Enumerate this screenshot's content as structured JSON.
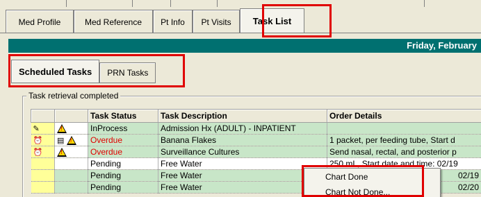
{
  "main_tabs": [
    {
      "label": "Med Profile",
      "active": false
    },
    {
      "label": "Med Reference",
      "active": false
    },
    {
      "label": "Pt Info",
      "active": false
    },
    {
      "label": "Pt Visits",
      "active": false
    },
    {
      "label": "Task List",
      "active": true
    }
  ],
  "date_header": "Friday, February",
  "sub_tabs": [
    {
      "label": "Scheduled Tasks",
      "active": true
    },
    {
      "label": "PRN Tasks",
      "active": false
    }
  ],
  "group_label": "Task retrieval completed",
  "table": {
    "headers": [
      "",
      "",
      "Task Status",
      "Task Description",
      "Order Details"
    ],
    "rows": [
      {
        "status": "InProcess",
        "description": "Admission Hx (ADULT) - INPATIENT",
        "details": "",
        "style": "green",
        "icons": [
          "pencil-icon",
          "warning-icon"
        ]
      },
      {
        "status": "Overdue",
        "description": "Banana Flakes",
        "details": "1 packet, per feeding tube, Start d",
        "style": "green",
        "icons": [
          "clock-icon",
          "note-icon",
          "warning-icon"
        ]
      },
      {
        "status": "Overdue",
        "description": "Surveillance Cultures",
        "details": "Send nasal, rectal, and posterior p",
        "style": "green",
        "icons": [
          "clock-icon",
          "",
          "warning-icon"
        ]
      },
      {
        "status": "Pending",
        "description": "Free Water",
        "details": "250 mL, Start date and time: 02/19",
        "style": "white",
        "icons": []
      },
      {
        "status": "Pending",
        "description": "Free Water",
        "details": "02/19",
        "style": "green",
        "icons": []
      },
      {
        "status": "Pending",
        "description": "Free Water",
        "details": "02/20",
        "style": "green",
        "icons": []
      }
    ]
  },
  "context_menu": {
    "items": [
      "Chart Done",
      "Chart Not Done..."
    ]
  },
  "colors": {
    "date_bar": "#007070",
    "row_green": "#c8e6c8",
    "overdue_text": "#e00000",
    "highlight": "#e00000"
  }
}
